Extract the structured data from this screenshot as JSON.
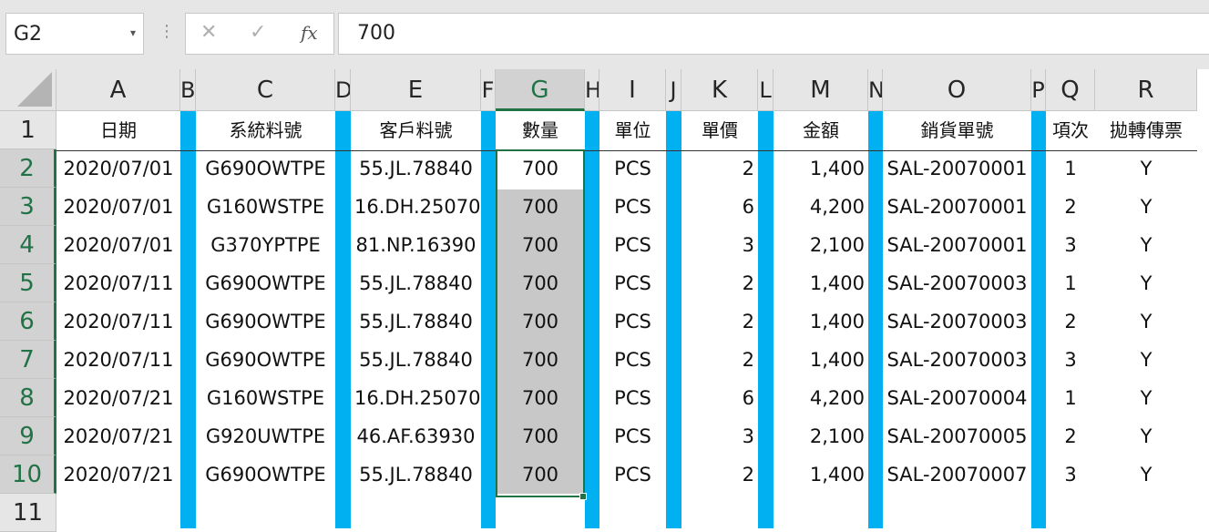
{
  "name_box": {
    "value": "G2"
  },
  "formula_bar": {
    "value": "700"
  },
  "icons": {
    "cancel": "✕",
    "enter": "✓",
    "function": "fx",
    "more": "⋮",
    "dropdown": "▾"
  },
  "colors": {
    "accent": "#217346",
    "stripe": "#00b0f0",
    "selection": "#c8c8c8"
  },
  "column_letters": [
    "A",
    "B",
    "C",
    "D",
    "E",
    "F",
    "G",
    "H",
    "I",
    "J",
    "K",
    "L",
    "M",
    "N",
    "O",
    "P",
    "Q",
    "R"
  ],
  "row_numbers": [
    "1",
    "2",
    "3",
    "4",
    "5",
    "6",
    "7",
    "8",
    "9",
    "10",
    "11"
  ],
  "headers": [
    "日期",
    "系統料號",
    "客戶料號",
    "數量",
    "單位",
    "單價",
    "金額",
    "銷貨單號",
    "項次",
    "拋轉傳票"
  ],
  "rows": [
    [
      "2020/07/01",
      "G690OWTPE",
      "55.JL.78840",
      "700",
      "PCS",
      "2",
      "1,400",
      "SAL-20070001",
      "1",
      "Y"
    ],
    [
      "2020/07/01",
      "G160WSTPE",
      "16.DH.25070",
      "700",
      "PCS",
      "6",
      "4,200",
      "SAL-20070001",
      "2",
      "Y"
    ],
    [
      "2020/07/01",
      "G370YPTPE",
      "81.NP.16390",
      "700",
      "PCS",
      "3",
      "2,100",
      "SAL-20070001",
      "3",
      "Y"
    ],
    [
      "2020/07/11",
      "G690OWTPE",
      "55.JL.78840",
      "700",
      "PCS",
      "2",
      "1,400",
      "SAL-20070003",
      "1",
      "Y"
    ],
    [
      "2020/07/11",
      "G690OWTPE",
      "55.JL.78840",
      "700",
      "PCS",
      "2",
      "1,400",
      "SAL-20070003",
      "2",
      "Y"
    ],
    [
      "2020/07/11",
      "G690OWTPE",
      "55.JL.78840",
      "700",
      "PCS",
      "2",
      "1,400",
      "SAL-20070003",
      "3",
      "Y"
    ],
    [
      "2020/07/21",
      "G160WSTPE",
      "16.DH.25070",
      "700",
      "PCS",
      "6",
      "4,200",
      "SAL-20070004",
      "1",
      "Y"
    ],
    [
      "2020/07/21",
      "G920UWTPE",
      "46.AF.63930",
      "700",
      "PCS",
      "3",
      "2,100",
      "SAL-20070005",
      "2",
      "Y"
    ],
    [
      "2020/07/21",
      "G690OWTPE",
      "55.JL.78840",
      "700",
      "PCS",
      "2",
      "1,400",
      "SAL-20070007",
      "3",
      "Y"
    ]
  ]
}
